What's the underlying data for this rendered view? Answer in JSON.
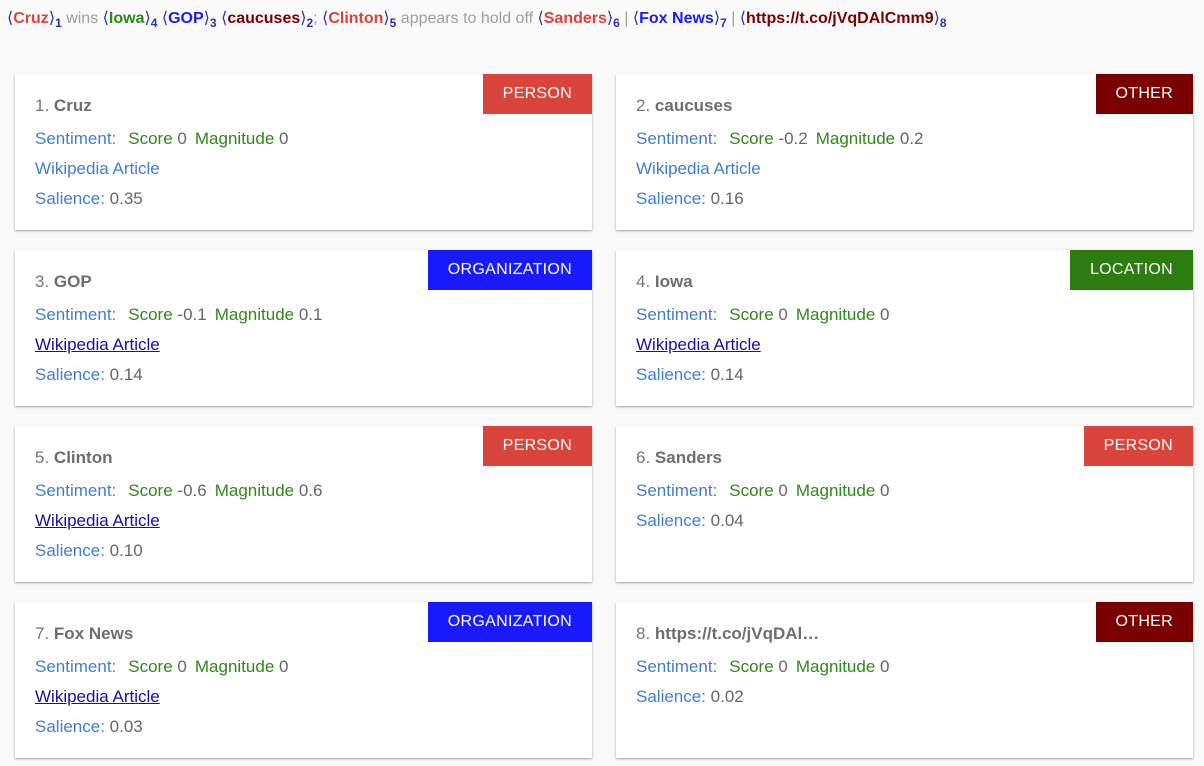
{
  "header": {
    "tokens": [
      {
        "text": "Cruz",
        "index": "1",
        "color": "#d9443c"
      },
      {
        "text": " wins ",
        "plain": true
      },
      {
        "text": "Iowa",
        "index": "4",
        "color": "#2c8a16"
      },
      {
        "text": " ",
        "plain": true
      },
      {
        "text": "GOP",
        "index": "3",
        "color": "#1a1aff"
      },
      {
        "text": " ",
        "plain": true
      },
      {
        "text": "caucuses",
        "index": "2",
        "color": "#7a0000"
      },
      {
        "text": "; ",
        "plain": true
      },
      {
        "text": "Clinton",
        "index": "5",
        "color": "#d9443c"
      },
      {
        "text": " appears to hold off ",
        "plain": true
      },
      {
        "text": "Sanders",
        "index": "6",
        "color": "#d9443c"
      },
      {
        "text": " | ",
        "plain": true
      },
      {
        "text": "Fox News",
        "index": "7",
        "color": "#1a1aff"
      },
      {
        "text": " | ",
        "plain": true
      },
      {
        "text": "https://t.co/jVqDAlCmm9",
        "index": "8",
        "color": "#7a0000"
      }
    ]
  },
  "labels": {
    "sentiment": "Sentiment:",
    "score": "Score",
    "magnitude": "Magnitude",
    "wikipedia": "Wikipedia Article",
    "salience": "Salience:"
  },
  "colors": {
    "PERSON": "#d9443c",
    "OTHER": "#7a0000",
    "ORGANIZATION": "#1a1aff",
    "LOCATION": "#2c7d0f"
  },
  "cards": [
    {
      "num": "1.",
      "name": "Cruz",
      "type": "PERSON",
      "score": "0",
      "magnitude": "0",
      "wiki": true,
      "wiki_link": false,
      "salience": "0.35"
    },
    {
      "num": "2.",
      "name": "caucuses",
      "type": "OTHER",
      "score": "-0.2",
      "magnitude": "0.2",
      "wiki": true,
      "wiki_link": false,
      "salience": "0.16"
    },
    {
      "num": "3.",
      "name": "GOP",
      "type": "ORGANIZATION",
      "score": "-0.1",
      "magnitude": "0.1",
      "wiki": true,
      "wiki_link": true,
      "salience": "0.14"
    },
    {
      "num": "4.",
      "name": "Iowa",
      "type": "LOCATION",
      "score": "0",
      "magnitude": "0",
      "wiki": true,
      "wiki_link": true,
      "salience": "0.14"
    },
    {
      "num": "5.",
      "name": "Clinton",
      "type": "PERSON",
      "score": "-0.6",
      "magnitude": "0.6",
      "wiki": true,
      "wiki_link": true,
      "salience": "0.10"
    },
    {
      "num": "6.",
      "name": "Sanders",
      "type": "PERSON",
      "score": "0",
      "magnitude": "0",
      "wiki": false,
      "wiki_link": false,
      "salience": "0.04"
    },
    {
      "num": "7.",
      "name": "Fox News",
      "type": "ORGANIZATION",
      "score": "0",
      "magnitude": "0",
      "wiki": true,
      "wiki_link": true,
      "salience": "0.03"
    },
    {
      "num": "8.",
      "name": "https://t.co/jVqDAl…",
      "type": "OTHER",
      "score": "0",
      "magnitude": "0",
      "wiki": false,
      "wiki_link": false,
      "salience": "0.02"
    }
  ]
}
